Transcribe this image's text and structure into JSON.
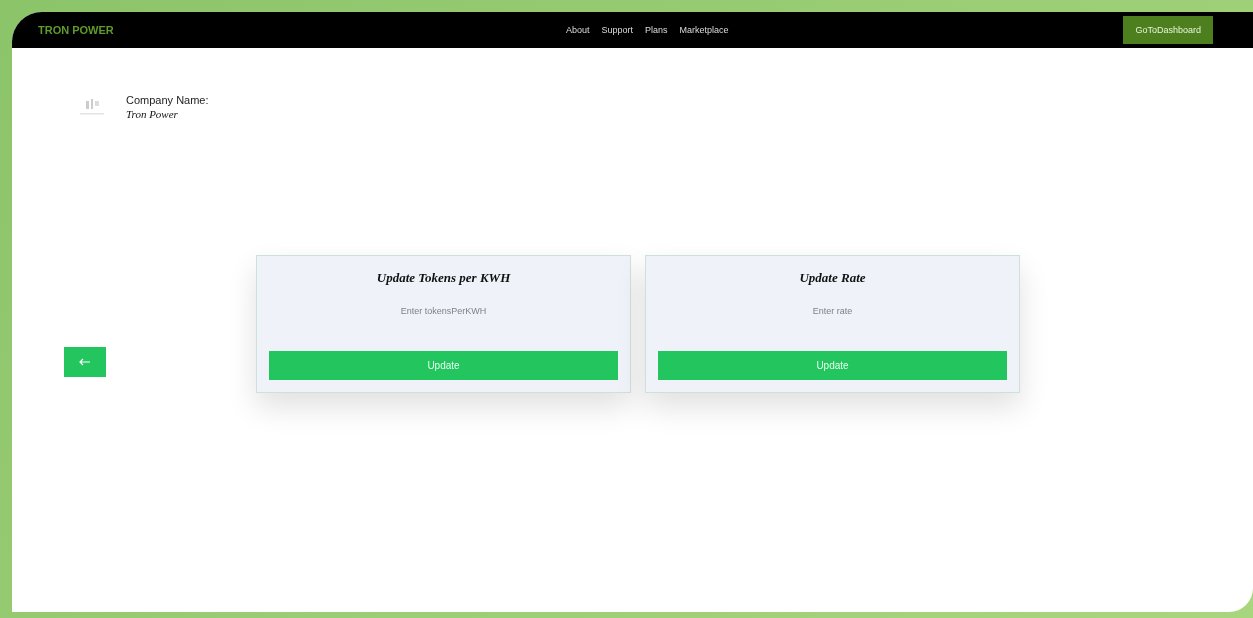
{
  "navbar": {
    "brand": "TRON POWER",
    "links": [
      "About",
      "Support",
      "Plans",
      "Marketplace"
    ],
    "action": "GoToDashboard"
  },
  "company": {
    "label": "Company Name:",
    "name": "Tron Power"
  },
  "forms": [
    {
      "title": "Update Tokens per KWH",
      "placeholder": "Enter tokensPerKWH",
      "button": "Update"
    },
    {
      "title": "Update Rate",
      "placeholder": "Enter rate",
      "button": "Update"
    }
  ]
}
